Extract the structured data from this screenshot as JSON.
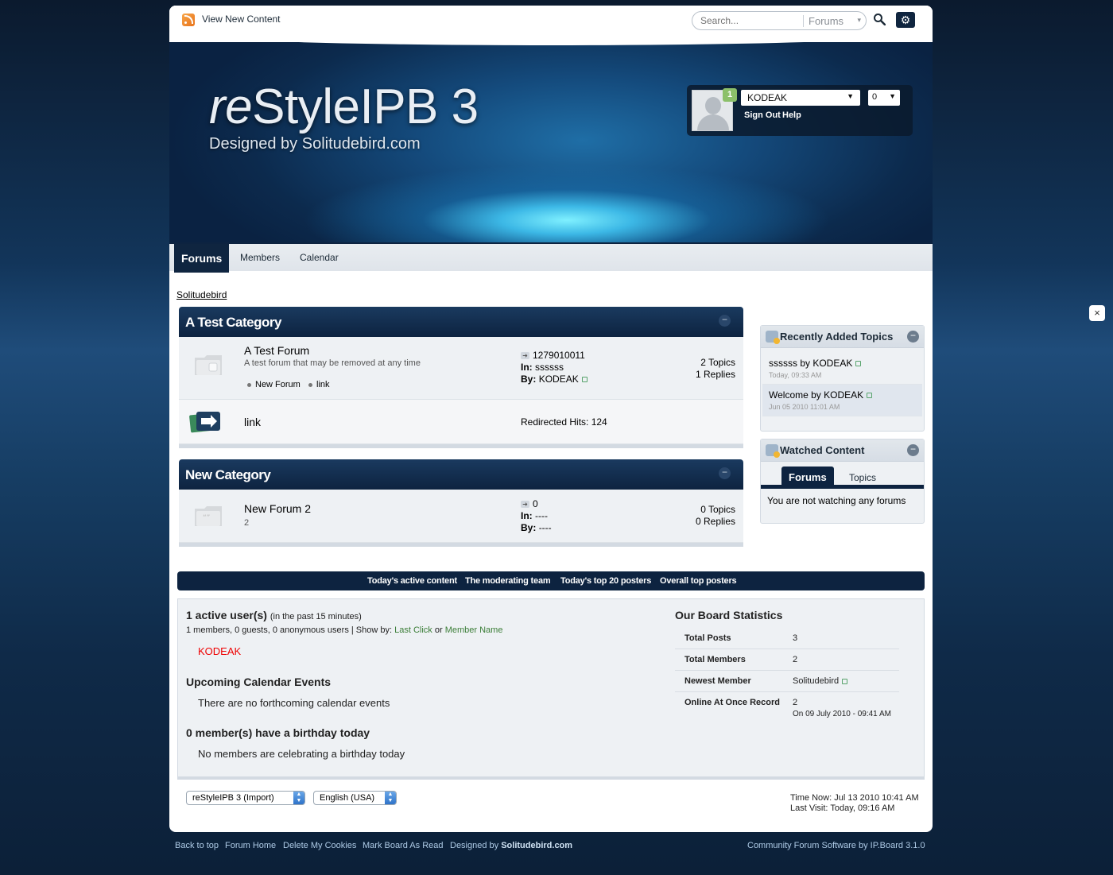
{
  "top": {
    "view_new": "View New Content",
    "search_placeholder": "Search...",
    "search_scope": "Forums"
  },
  "header": {
    "logo_prefix": "re",
    "logo_main": "StyleIPB 3",
    "subtitle": "Designed by Solitudebird.com"
  },
  "user": {
    "notifications": "1",
    "name": "KODEAK",
    "count": "0",
    "sign_out": "Sign Out",
    "help": "Help"
  },
  "nav": {
    "tabs": [
      {
        "label": "Forums"
      },
      {
        "label": "Members"
      },
      {
        "label": "Calendar"
      }
    ]
  },
  "breadcrumb": "Solitudebird",
  "categories": [
    {
      "title": "A Test Category",
      "forums": [
        {
          "name": "A Test Forum",
          "desc": "A test forum that may be removed at any time",
          "subforums": [
            "New Forum",
            "link"
          ],
          "last_title": "1279010011",
          "in_label": "In:",
          "in_val": "ssssss",
          "by_label": "By:",
          "by_val": "KODEAK",
          "topics": "2 Topics",
          "replies": "1 Replies"
        },
        {
          "name": "link",
          "redirect": "Redirected Hits: 124"
        }
      ]
    },
    {
      "title": "New Category",
      "forums": [
        {
          "name": "New Forum 2",
          "desc": "2",
          "last_title": "0",
          "in_label": "In:",
          "in_val": "----",
          "by_label": "By:",
          "by_val": "----",
          "topics": "0 Topics",
          "replies": "0 Replies"
        }
      ]
    }
  ],
  "sidebar": {
    "recent": {
      "title": "Recently Added Topics",
      "items": [
        {
          "title": "ssssss by KODEAK",
          "date": "Today, 09:33 AM"
        },
        {
          "title": "Welcome by KODEAK",
          "date": "Jun 05 2010 11:01 AM"
        }
      ]
    },
    "watched": {
      "title": "Watched Content",
      "tabs": [
        "Forums",
        "Topics"
      ],
      "empty": "You are not watching any forums"
    }
  },
  "stats_bar": {
    "links": [
      "Today's active content",
      "The moderating team",
      "Today's top 20 posters",
      "Overall top posters"
    ]
  },
  "board": {
    "active_title": "1 active user(s)",
    "active_note": "(in the past 15 minutes)",
    "active_detail": "1 members, 0 guests, 0 anonymous users | Show by:",
    "last_click": "Last Click",
    "or": "or",
    "member_name": "Member Name",
    "active_user": "KODEAK",
    "calendar_title": "Upcoming Calendar Events",
    "calendar_text": "There are no forthcoming calendar events",
    "birthday_title": "0 member(s) have a birthday today",
    "birthday_text": "No members are celebrating a birthday today",
    "stats_title": "Our Board Statistics",
    "stats": [
      {
        "label": "Total Posts",
        "value": "3"
      },
      {
        "label": "Total Members",
        "value": "2"
      },
      {
        "label": "Newest Member",
        "value": "Solitudebird"
      },
      {
        "label": "Online At Once Record",
        "value": "2",
        "sub": "On 09 July 2010 - 09:41 AM"
      }
    ]
  },
  "footer": {
    "skin": "reStyleIPB 3 (Import)",
    "language": "English (USA)",
    "time_now": "Time Now: Jul 13 2010 10:41 AM",
    "last_visit": "Last Visit: Today, 09:16 AM",
    "links": [
      "Back to top",
      "Forum Home",
      "Delete My Cookies",
      "Mark Board As Read"
    ],
    "designed_prefix": "Designed by",
    "designed_name": "Solitudebird.com",
    "powered": "Community Forum Software by IP.Board 3.1.0"
  },
  "close": "×"
}
